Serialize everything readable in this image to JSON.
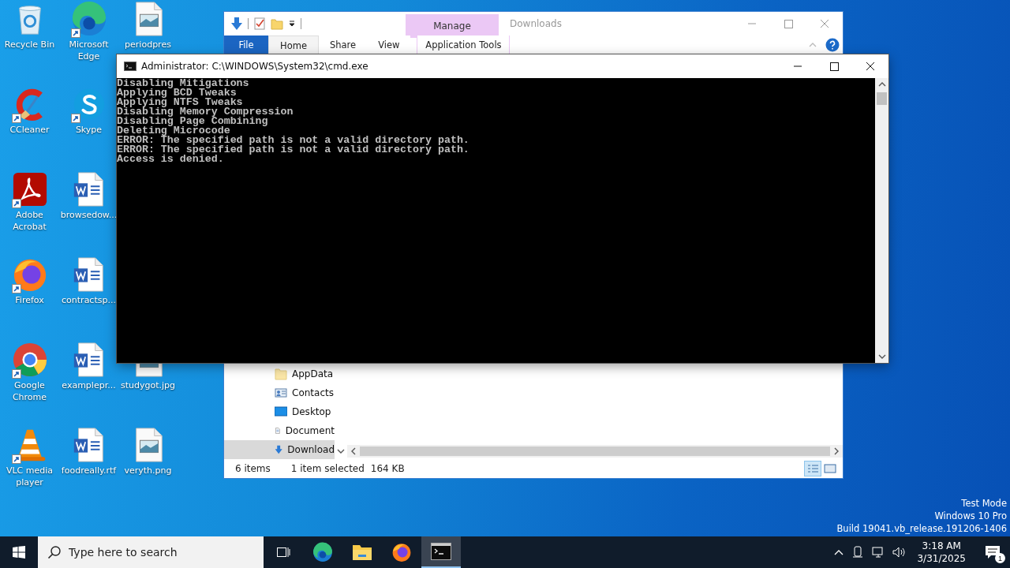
{
  "desktop": {
    "icons": [
      {
        "label": "Recycle Bin",
        "kind": "recycle",
        "shortcut": false
      },
      {
        "label": "CCleaner",
        "kind": "ccleaner",
        "shortcut": true
      },
      {
        "label": "Adobe Acrobat",
        "kind": "acrobat",
        "shortcut": true
      },
      {
        "label": "Firefox",
        "kind": "firefox",
        "shortcut": true
      },
      {
        "label": "Google Chrome",
        "kind": "chrome",
        "shortcut": true
      },
      {
        "label": "VLC media player",
        "kind": "vlc",
        "shortcut": true
      },
      {
        "label": "Microsoft Edge",
        "kind": "edge",
        "shortcut": true
      },
      {
        "label": "Skype",
        "kind": "skype",
        "shortcut": true
      },
      {
        "label": "browsedow...",
        "kind": "word",
        "shortcut": false
      },
      {
        "label": "contractsp...",
        "kind": "word",
        "shortcut": false
      },
      {
        "label": "examplepr...",
        "kind": "word",
        "shortcut": false
      },
      {
        "label": "foodreally.rtf",
        "kind": "word",
        "shortcut": false
      },
      {
        "label": "periodpres",
        "kind": "image",
        "shortcut": false
      },
      {
        "label": "studygot.jpg",
        "kind": "image",
        "shortcut": false
      },
      {
        "label": "veryth.png",
        "kind": "image",
        "shortcut": false
      }
    ],
    "system_watermark": [
      "Test Mode",
      "Windows 10 Pro",
      "Build 19041.vb_release.191206-1406"
    ]
  },
  "explorer": {
    "title": "Downloads",
    "context_header": "Manage",
    "tabs": [
      {
        "label": "File",
        "kind": "file",
        "selected": false
      },
      {
        "label": "Home",
        "kind": "tab",
        "selected": true
      },
      {
        "label": "Share",
        "kind": "tab",
        "selected": false
      },
      {
        "label": "View",
        "kind": "tab",
        "selected": false
      },
      {
        "label": "Application Tools",
        "kind": "contextual",
        "selected": false
      }
    ],
    "nav_items": [
      {
        "label": "AppData",
        "kind": "folder",
        "selected": false
      },
      {
        "label": "Contacts",
        "kind": "contacts",
        "selected": false
      },
      {
        "label": "Desktop",
        "kind": "desktop",
        "selected": false
      },
      {
        "label": "Document",
        "kind": "documents",
        "selected": false
      },
      {
        "label": "Download",
        "kind": "downloads",
        "selected": true
      }
    ],
    "status": {
      "items": "6 items",
      "selection": "1 item selected",
      "size": "164 KB"
    }
  },
  "console": {
    "title": "Administrator: C:\\WINDOWS\\System32\\cmd.exe",
    "lines": [
      "Disabling Mitigations",
      "Applying BCD Tweaks",
      "Applying NTFS Tweaks",
      "Disabling Memory Compression",
      "Disabling Page Combining",
      "Deleting Microcode",
      "ERROR: The specified path is not a valid directory path.",
      "ERROR: The specified path is not a valid directory path.",
      "Access is denied."
    ]
  },
  "taskbar": {
    "search": {
      "placeholder": "Type here to search"
    },
    "apps": [
      {
        "kind": "edge",
        "active": false
      },
      {
        "kind": "folder",
        "active": false
      },
      {
        "kind": "firefox",
        "active": false
      },
      {
        "kind": "console",
        "active": true
      }
    ],
    "clock": {
      "time": "3:18 AM",
      "date": "3/31/2025"
    },
    "notification_count": "1"
  }
}
